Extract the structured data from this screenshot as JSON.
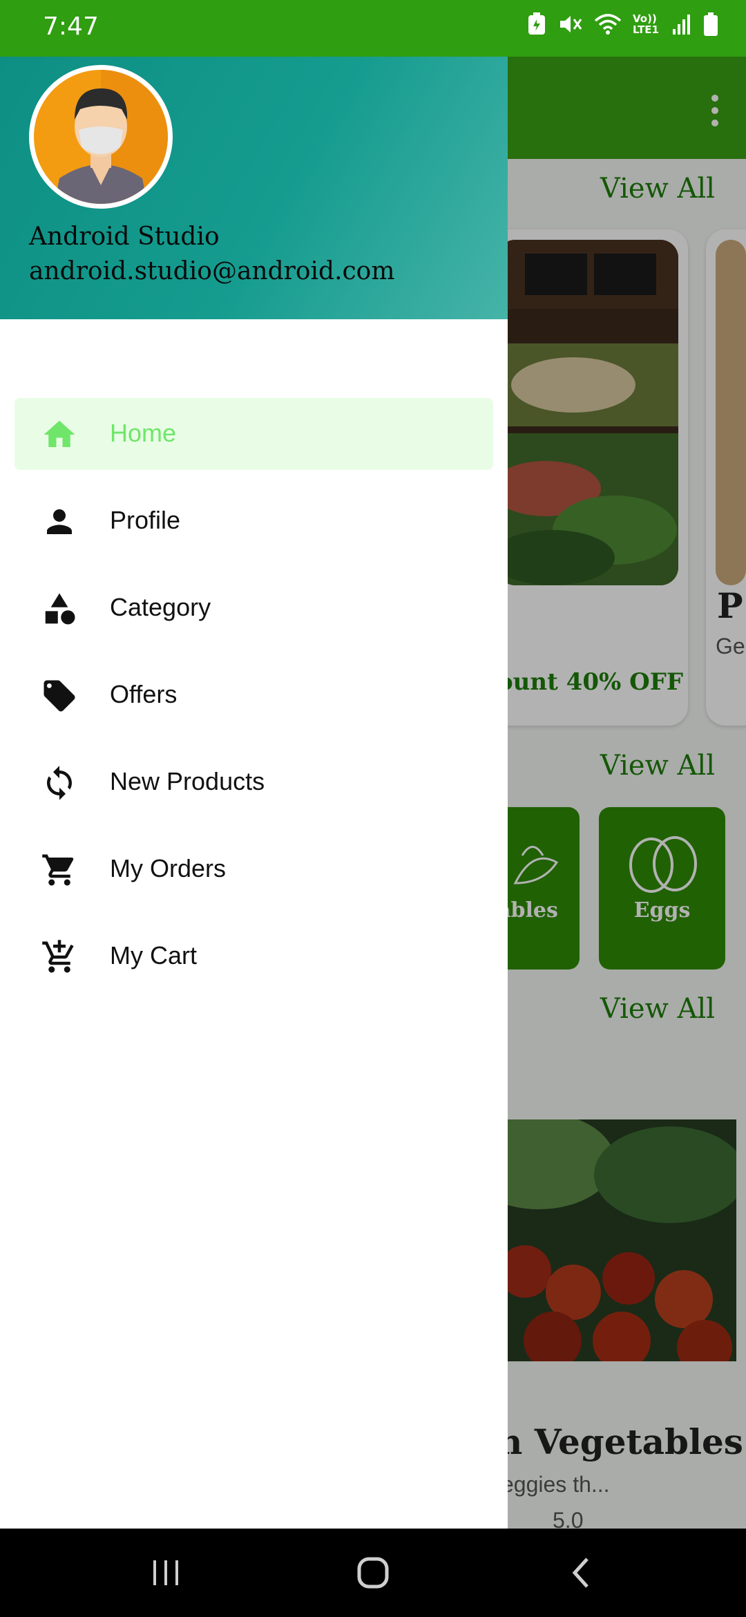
{
  "status_bar": {
    "time": "7:47",
    "icons": [
      "battery-saver-icon",
      "mute-icon",
      "wifi-icon",
      "volte-icon",
      "signal-icon",
      "battery-icon"
    ],
    "volte_text": "Vo)) LTE1"
  },
  "drawer": {
    "header": {
      "name": "Android Studio",
      "email": "android.studio@android.com"
    },
    "items": [
      {
        "label": "Home",
        "icon": "home-icon",
        "active": true
      },
      {
        "label": "Profile",
        "icon": "person-icon",
        "active": false
      },
      {
        "label": "Category",
        "icon": "category-icon",
        "active": false
      },
      {
        "label": "Offers",
        "icon": "tag-icon",
        "active": false
      },
      {
        "label": "New Products",
        "icon": "refresh-icon",
        "active": false
      },
      {
        "label": "My Orders",
        "icon": "cart-icon",
        "active": false
      },
      {
        "label": "My Cart",
        "icon": "add-cart-icon",
        "active": false
      }
    ]
  },
  "background": {
    "view_all_1": "View All",
    "view_all_2": "View All",
    "view_all_3": "View All",
    "discount_text": "ount 40% OFF",
    "card2_initial": "P",
    "card2_sub": "Ge",
    "cat_vegetables": "etables",
    "cat_eggs": "Eggs",
    "product_title": "n Vegetables",
    "product_sub": "eggies th...",
    "product_rating": "5.0"
  },
  "colors": {
    "status_bar": "#2f9e10",
    "header_gradient_start": "#0e8f83",
    "header_gradient_end": "#46b3a8",
    "active_bg": "#e9fde6",
    "active_fg": "#6fe66a"
  }
}
